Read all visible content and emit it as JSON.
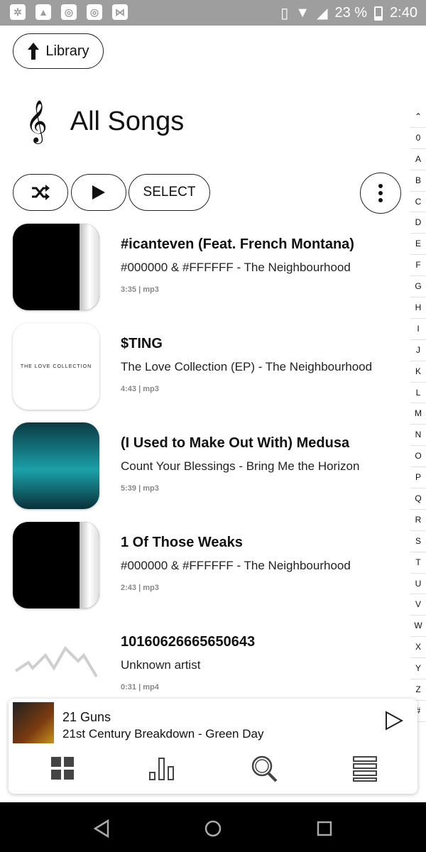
{
  "status_bar": {
    "battery": "23 %",
    "time": "2:40",
    "battery_level": 0.23
  },
  "header": {
    "back_label": "Library",
    "title": "All Songs"
  },
  "actions": {
    "select_label": "SELECT"
  },
  "alphabet": [
    "0",
    "A",
    "B",
    "C",
    "D",
    "E",
    "F",
    "G",
    "H",
    "I",
    "J",
    "K",
    "L",
    "M",
    "N",
    "O",
    "P",
    "Q",
    "R",
    "S",
    "T",
    "U",
    "V",
    "W",
    "X",
    "Y",
    "Z",
    "#"
  ],
  "songs": [
    {
      "title": "#icanteven (Feat. French Montana)",
      "subtitle": "#000000 & #FFFFFF - The Neighbourhood",
      "meta": "3:35 | mp3"
    },
    {
      "title": "$TING",
      "subtitle": "The Love Collection (EP) - The Neighbourhood",
      "meta": "4:43 | mp3",
      "art_text": "THE LOVE COLLECTION"
    },
    {
      "title": "(I Used to Make Out With) Medusa",
      "subtitle": "Count Your Blessings - Bring Me the Horizon",
      "meta": "5:39 | mp3"
    },
    {
      "title": "1 Of Those Weaks",
      "subtitle": "#000000 & #FFFFFF - The Neighbourhood",
      "meta": "2:43 | mp3"
    },
    {
      "title": "10160626665650643",
      "subtitle": "Unknown artist",
      "meta": "0:31 | mp4"
    }
  ],
  "now_playing": {
    "title": "21 Guns",
    "subtitle": "21st Century Breakdown - Green Day"
  },
  "icons": {
    "status": [
      "settings-icon",
      "gallery-icon",
      "instagram-icon",
      "instagram-icon",
      "app-icon"
    ],
    "tabs": [
      "grid-icon",
      "bars-icon",
      "search-icon",
      "list-icon"
    ],
    "nav": [
      "back-icon",
      "home-icon",
      "recents-icon"
    ]
  }
}
